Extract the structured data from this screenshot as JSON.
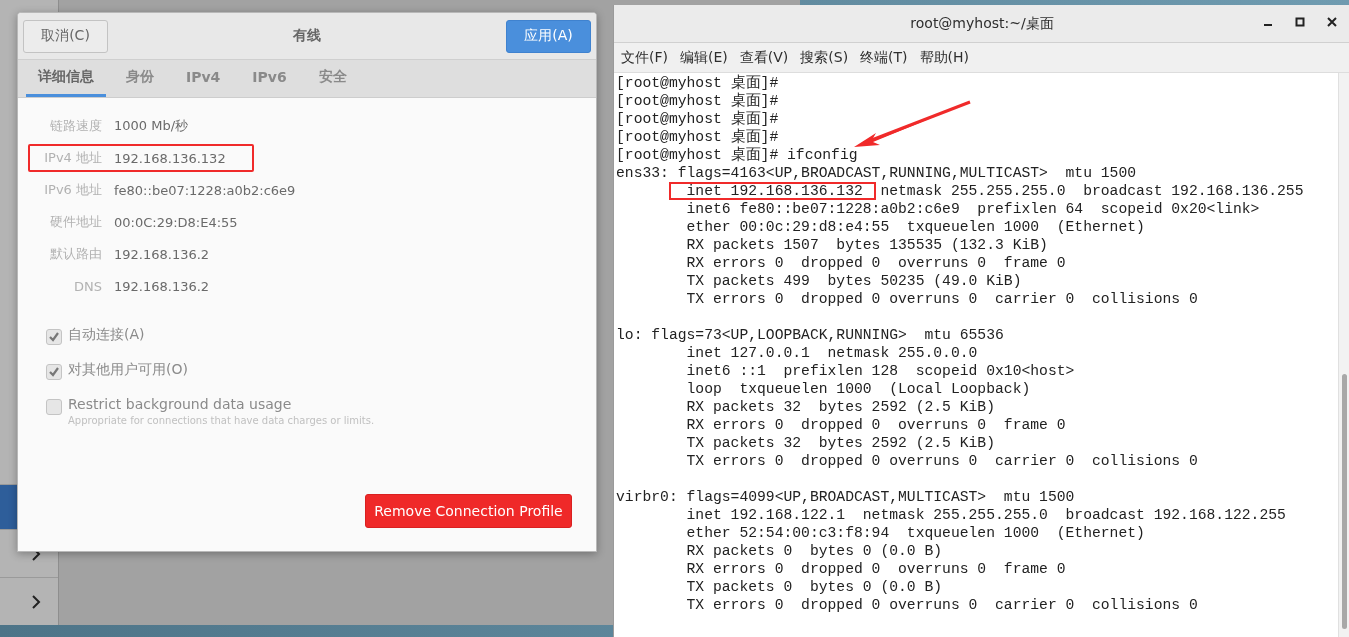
{
  "background_window": {
    "sidebar_rows": [
      {
        "selected": true
      },
      {
        "selected": false
      },
      {
        "selected": false
      }
    ]
  },
  "dialog": {
    "cancel_button": "取消(C)",
    "title": "有线",
    "apply_button": "应用(A)",
    "tabs": [
      {
        "label": "详细信息",
        "selected": true
      },
      {
        "label": "身份",
        "selected": false
      },
      {
        "label": "IPv4",
        "selected": false
      },
      {
        "label": "IPv6",
        "selected": false
      },
      {
        "label": "安全",
        "selected": false
      }
    ],
    "details": [
      {
        "label": "链路速度",
        "value": "1000 Mb/秒"
      },
      {
        "label": "IPv4 地址",
        "value": "192.168.136.132",
        "boxed": true
      },
      {
        "label": "IPv6 地址",
        "value": "fe80::be07:1228:a0b2:c6e9"
      },
      {
        "label": "硬件地址",
        "value": "00:0C:29:D8:E4:55"
      },
      {
        "label": "默认路由",
        "value": "192.168.136.2"
      },
      {
        "label": "DNS",
        "value": "192.168.136.2"
      }
    ],
    "checkboxes": [
      {
        "label": "自动连接(A)",
        "checked": true
      },
      {
        "label": "对其他用户可用(O)",
        "checked": true
      },
      {
        "label": "Restrict background data usage",
        "description": "Appropriate for connections that have data charges or limits.",
        "checked": false
      }
    ],
    "remove_button": "Remove Connection Profile"
  },
  "terminal": {
    "title": "root@myhost:~/桌面",
    "menu": [
      "文件(F)",
      "编辑(E)",
      "查看(V)",
      "搜索(S)",
      "终端(T)",
      "帮助(H)"
    ],
    "lines": [
      {
        "kind": "text",
        "text": "[root@myhost 桌面]#"
      },
      {
        "kind": "text",
        "text": "[root@myhost 桌面]#"
      },
      {
        "kind": "text",
        "text": "[root@myhost 桌面]#"
      },
      {
        "kind": "text",
        "text": "[root@myhost 桌面]#"
      },
      {
        "kind": "text",
        "text": "[root@myhost 桌面]# ifconfig"
      },
      {
        "kind": "text",
        "text": "ens33: flags=4163<UP,BROADCAST,RUNNING,MULTICAST>  mtu 1500"
      },
      {
        "kind": "boxed",
        "boxed": "inet 192.168.136.132",
        "text": "netmask 255.255.255.0  broadcast 192.168.136.255"
      },
      {
        "kind": "text",
        "text": "        inet6 fe80::be07:1228:a0b2:c6e9  prefixlen 64  scopeid 0x20<link>"
      },
      {
        "kind": "text",
        "text": "        ether 00:0c:29:d8:e4:55  txqueuelen 1000  (Ethernet)"
      },
      {
        "kind": "text",
        "text": "        RX packets 1507  bytes 135535 (132.3 KiB)"
      },
      {
        "kind": "text",
        "text": "        RX errors 0  dropped 0  overruns 0  frame 0"
      },
      {
        "kind": "text",
        "text": "        TX packets 499  bytes 50235 (49.0 KiB)"
      },
      {
        "kind": "text",
        "text": "        TX errors 0  dropped 0 overruns 0  carrier 0  collisions 0"
      },
      {
        "kind": "blank"
      },
      {
        "kind": "text",
        "text": "lo: flags=73<UP,LOOPBACK,RUNNING>  mtu 65536"
      },
      {
        "kind": "text",
        "text": "        inet 127.0.0.1  netmask 255.0.0.0"
      },
      {
        "kind": "text",
        "text": "        inet6 ::1  prefixlen 128  scopeid 0x10<host>"
      },
      {
        "kind": "text",
        "text": "        loop  txqueuelen 1000  (Local Loopback)"
      },
      {
        "kind": "text",
        "text": "        RX packets 32  bytes 2592 (2.5 KiB)"
      },
      {
        "kind": "text",
        "text": "        RX errors 0  dropped 0  overruns 0  frame 0"
      },
      {
        "kind": "text",
        "text": "        TX packets 32  bytes 2592 (2.5 KiB)"
      },
      {
        "kind": "text",
        "text": "        TX errors 0  dropped 0 overruns 0  carrier 0  collisions 0"
      },
      {
        "kind": "blank"
      },
      {
        "kind": "text",
        "text": "virbr0: flags=4099<UP,BROADCAST,MULTICAST>  mtu 1500"
      },
      {
        "kind": "text",
        "text": "        inet 192.168.122.1  netmask 255.255.255.0  broadcast 192.168.122.255"
      },
      {
        "kind": "text",
        "text": "        ether 52:54:00:c3:f8:94  txqueuelen 1000  (Ethernet)"
      },
      {
        "kind": "text",
        "text": "        RX packets 0  bytes 0 (0.0 B)"
      },
      {
        "kind": "text",
        "text": "        RX errors 0  dropped 0  overruns 0  frame 0"
      },
      {
        "kind": "text",
        "text": "        TX packets 0  bytes 0 (0.0 B)"
      },
      {
        "kind": "text",
        "text": "        TX errors 0  dropped 0 overruns 0  carrier 0  collisions 0"
      }
    ]
  }
}
